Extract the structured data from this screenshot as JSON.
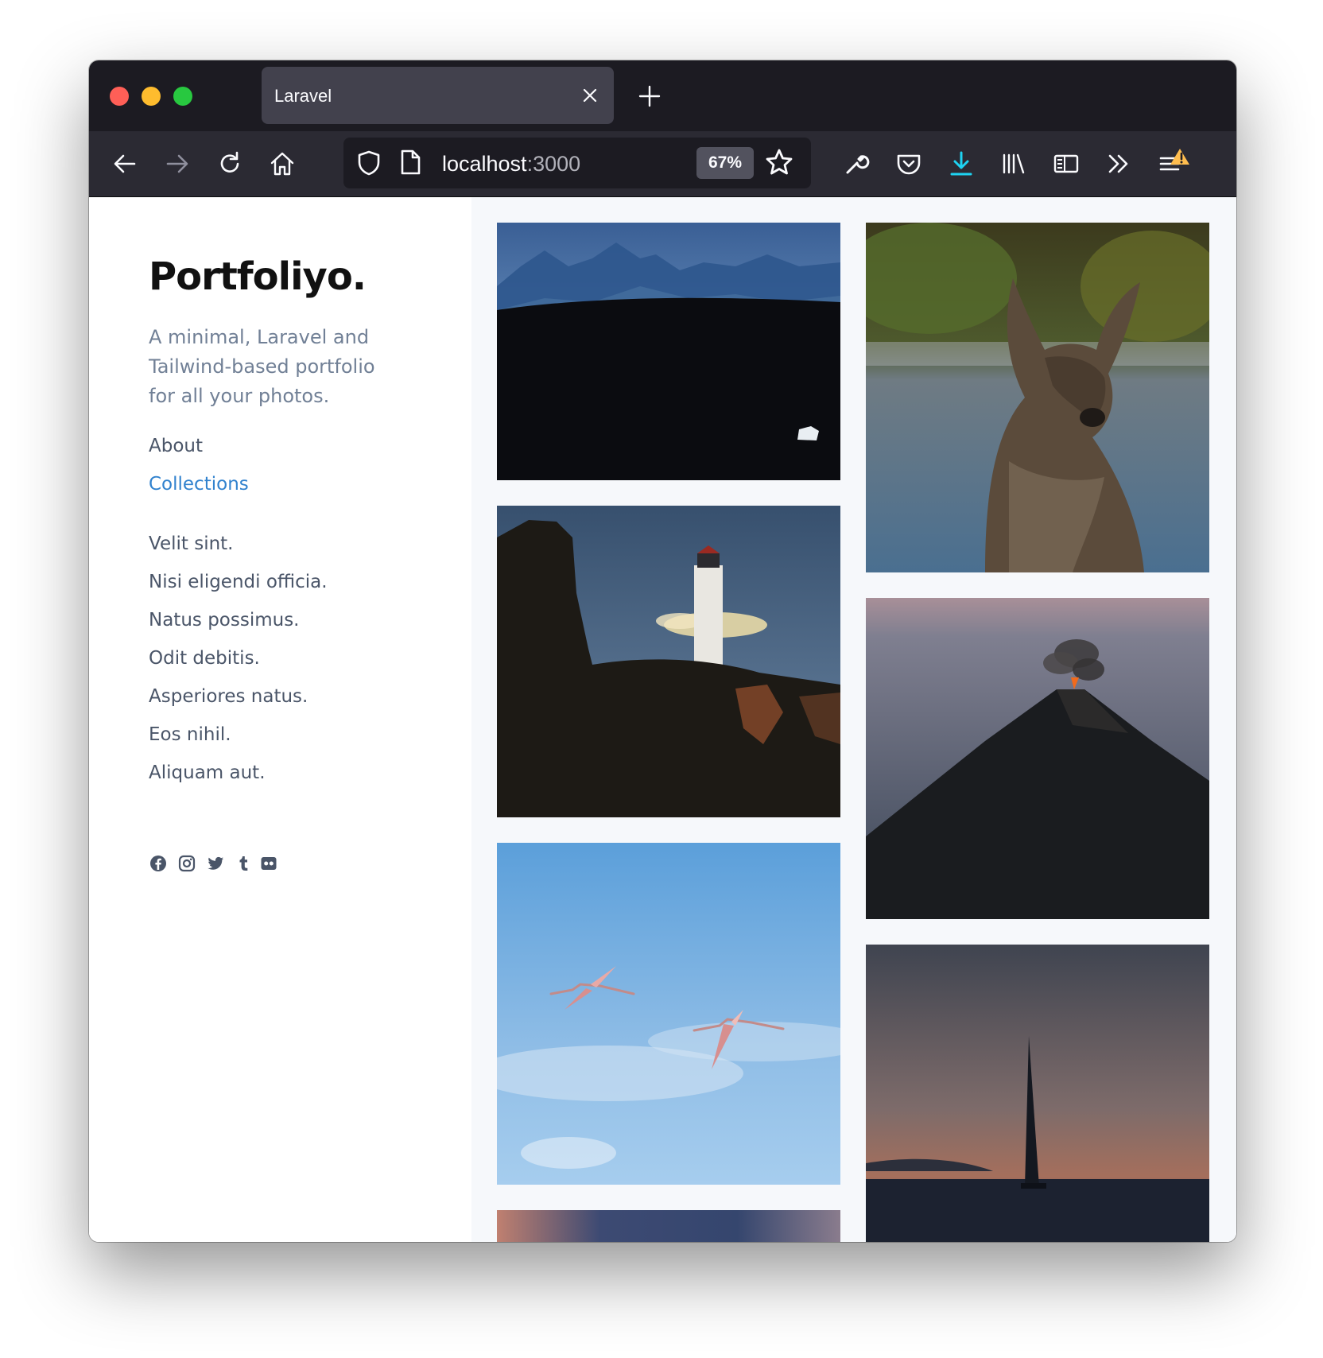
{
  "browser": {
    "tab_title": "Laravel",
    "url_host": "localhost",
    "url_port": ":3000",
    "zoom": "67%",
    "accent_color": "#1ed3f2"
  },
  "site": {
    "logo": "Portfoliyo.",
    "tagline": "A minimal, Laravel and Tailwind-based portfolio for all your photos.",
    "nav": [
      {
        "label": "About",
        "active": false
      },
      {
        "label": "Collections",
        "active": true
      }
    ],
    "collections": [
      "Velit sint.",
      "Nisi eligendi officia.",
      "Natus possimus.",
      "Odit debitis.",
      "Asperiores natus.",
      "Eos nihil.",
      "Aliquam aut."
    ],
    "social_icons": [
      "facebook-icon",
      "instagram-icon",
      "twitter-icon",
      "tumblr-icon",
      "flickr-icon"
    ],
    "photos": [
      {
        "subject": "blue mountain ridges above dark field"
      },
      {
        "subject": "wallaby in the rain"
      },
      {
        "subject": "lighthouse on cliff"
      },
      {
        "subject": "erupting volcano at dusk"
      },
      {
        "subject": "two flamingos in blue sky"
      },
      {
        "subject": "sailboat at sunset"
      },
      {
        "subject": "dusk clouds"
      }
    ]
  }
}
